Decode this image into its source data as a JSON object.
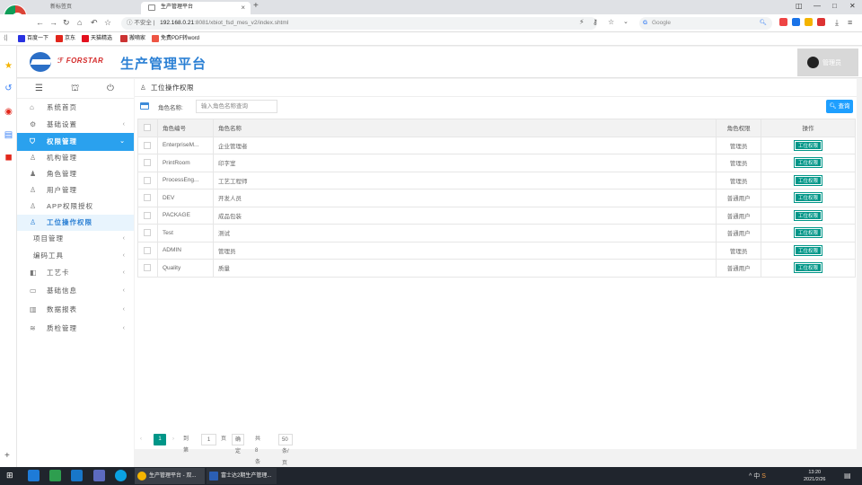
{
  "browser": {
    "tabs": [
      {
        "label": "新标签页",
        "active": false
      },
      {
        "label": "生产管理平台",
        "active": true
      }
    ],
    "url_warning": "不安全",
    "url_host": "192.168.0.21",
    "url_path": ":8081/xbiot_fsd_mes_v2/index.shtml",
    "search_placeholder": "Google",
    "bookmarks": [
      "百度一下",
      "京东",
      "天猫精选",
      "搬嘀家",
      "免费PDF转word"
    ],
    "window_controls": [
      "—",
      "□",
      "✕"
    ]
  },
  "app": {
    "brand": "FORSTAR",
    "title": "生产管理平台",
    "username": "管理员"
  },
  "sidebar": {
    "items": [
      {
        "label": "系统首页",
        "icon": "home-icon",
        "glyph": "⌂",
        "level": "top"
      },
      {
        "label": "基础设置",
        "icon": "gear-icon",
        "glyph": "⚙",
        "level": "top",
        "chevron": "‹"
      },
      {
        "label": "权限管理",
        "icon": "shield-icon",
        "glyph": "⛉",
        "level": "top-active",
        "chevron": "⌄"
      },
      {
        "label": "机构管理",
        "icon": "org-icon",
        "glyph": "♙",
        "level": "sub"
      },
      {
        "label": "角色管理",
        "icon": "role-icon",
        "glyph": "♟",
        "level": "sub"
      },
      {
        "label": "用户管理",
        "icon": "user-icon",
        "glyph": "♙",
        "level": "sub"
      },
      {
        "label": "APP权限授权",
        "icon": "user-icon",
        "glyph": "♙",
        "level": "sub"
      },
      {
        "label": "工位操作权限",
        "icon": "user-icon",
        "glyph": "♙",
        "level": "sub-active"
      },
      {
        "label": "项目管理",
        "icon": "",
        "glyph": "",
        "level": "plain",
        "chevron": "‹"
      },
      {
        "label": "编码工具",
        "icon": "",
        "glyph": "",
        "level": "plain",
        "chevron": "‹"
      },
      {
        "label": "工艺卡",
        "icon": "card-icon",
        "glyph": "◧",
        "level": "top",
        "chevron": "‹"
      },
      {
        "label": "基础信息",
        "icon": "monitor-icon",
        "glyph": "▭",
        "level": "top",
        "chevron": "‹"
      },
      {
        "label": "数据报表",
        "icon": "table-icon",
        "glyph": "▥",
        "level": "top",
        "chevron": "‹"
      },
      {
        "label": "质检管理",
        "icon": "layers-icon",
        "glyph": "≋",
        "level": "top",
        "chevron": "‹"
      }
    ]
  },
  "main": {
    "breadcrumb": "工位操作权限",
    "filter_label": "角色名称:",
    "filter_placeholder": "输入角色名称查询",
    "search_button": "查询",
    "columns": [
      "",
      "角色编号",
      "角色名称",
      "角色权限",
      "操作"
    ],
    "rows": [
      {
        "code": "EnterpriseM...",
        "name": "企业管理者",
        "perm": "管理员",
        "action": "工位权限"
      },
      {
        "code": "PrintRoom",
        "name": "印字室",
        "perm": "管理员",
        "action": "工位权限"
      },
      {
        "code": "ProcessEng...",
        "name": "工艺工程师",
        "perm": "管理员",
        "action": "工位权限"
      },
      {
        "code": "DEV",
        "name": "开发人员",
        "perm": "普通用户",
        "action": "工位权限"
      },
      {
        "code": "PACKAGE",
        "name": "成品包装",
        "perm": "普通用户",
        "action": "工位权限"
      },
      {
        "code": "Test",
        "name": "测试",
        "perm": "普通用户",
        "action": "工位权限"
      },
      {
        "code": "ADMIN",
        "name": "管理员",
        "perm": "管理员",
        "action": "工位权限"
      },
      {
        "code": "Quality",
        "name": "质量",
        "perm": "普通用户",
        "action": "工位权限"
      }
    ],
    "pager": {
      "prev": "‹",
      "current": "1",
      "next": "›",
      "goto_label": "到第",
      "goto_value": "1",
      "page_unit": "页",
      "confirm": "确定",
      "total": "共 8 条",
      "page_size": "50 条/页"
    }
  },
  "taskbar": {
    "tasks": [
      "生产管理平台 - 双...",
      "富士达2期生产管理..."
    ],
    "tray": "^ 中",
    "time": "13:20",
    "date": "2021/2/26"
  },
  "colors": {
    "accent": "#2aa1ee",
    "action": "#009688",
    "title": "#2a7fd4",
    "search": "#1e9fff"
  }
}
